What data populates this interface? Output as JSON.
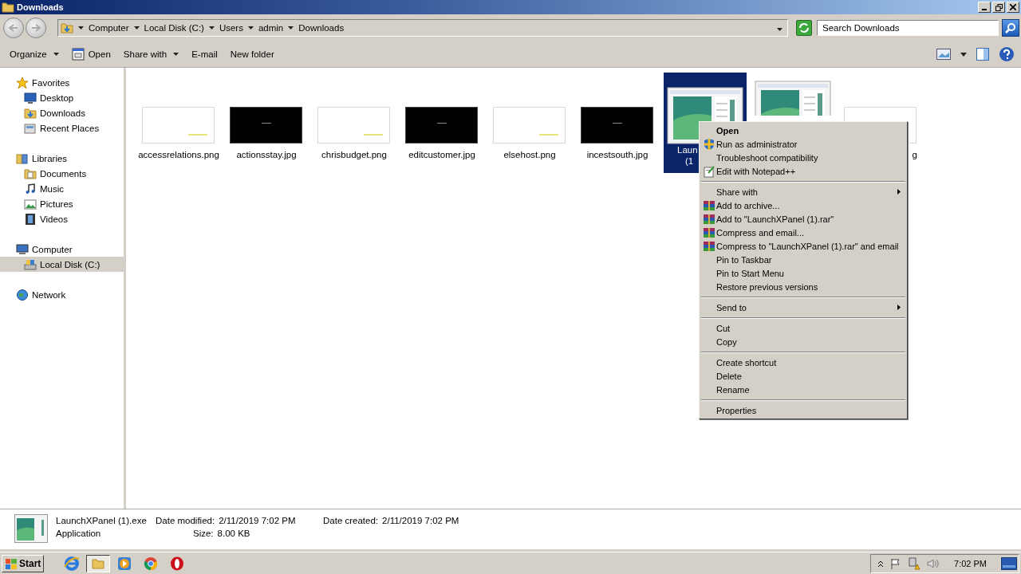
{
  "window": {
    "title": "Downloads"
  },
  "address": {
    "crumbs": [
      "Computer",
      "Local Disk (C:)",
      "Users",
      "admin",
      "Downloads"
    ]
  },
  "search": {
    "placeholder": "Search Downloads"
  },
  "toolbar": [
    {
      "label": "Organize",
      "kind": "dropdown"
    },
    {
      "label": "Open",
      "kind": "open"
    },
    {
      "label": "Share with",
      "kind": "dropdown"
    },
    {
      "label": "E-mail",
      "kind": "plain"
    },
    {
      "label": "New folder",
      "kind": "plain"
    }
  ],
  "sidebar": {
    "groups": [
      {
        "label": "Favorites",
        "kind": "star",
        "selected": false,
        "children": [
          {
            "label": "Desktop",
            "kind": "desktop",
            "selected": false
          },
          {
            "label": "Downloads",
            "kind": "folder",
            "selected": false
          },
          {
            "label": "Recent Places",
            "kind": "places",
            "selected": false
          }
        ]
      },
      {
        "label": "Libraries",
        "kind": "library",
        "selected": false,
        "children": [
          {
            "label": "Documents",
            "kind": "docs",
            "selected": false
          },
          {
            "label": "Music",
            "kind": "music",
            "selected": false
          },
          {
            "label": "Pictures",
            "kind": "pictures",
            "selected": false
          },
          {
            "label": "Videos",
            "kind": "videos",
            "selected": false
          }
        ]
      },
      {
        "label": "Computer",
        "kind": "computer",
        "selected": false,
        "children": [
          {
            "label": "Local Disk (C:)",
            "kind": "disk",
            "selected": true
          }
        ]
      },
      {
        "label": "Network",
        "kind": "network",
        "selected": false
      }
    ]
  },
  "files": [
    {
      "label": "accessrelations.png",
      "kind": "light",
      "selected": false
    },
    {
      "label": "actionsstay.jpg",
      "kind": "dark",
      "selected": false
    },
    {
      "label": "chrisbudget.png",
      "kind": "light",
      "selected": false
    },
    {
      "label": "editcustomer.jpg",
      "kind": "dark",
      "selected": false
    },
    {
      "label": "elsehost.png",
      "kind": "light",
      "selected": false
    },
    {
      "label": "incestsouth.jpg",
      "kind": "dark",
      "selected": false
    },
    {
      "label": "Laun",
      "label_2": "(1",
      "kind": "app",
      "selected": true
    },
    {
      "kind": "app_covered",
      "selected": false
    },
    {
      "label": "g",
      "kind": "blank",
      "selected": false
    }
  ],
  "context_menu": [
    {
      "kind": "plain",
      "label": "Open",
      "default": true
    },
    {
      "kind": "shield",
      "label": "Run as administrator",
      "default": false
    },
    {
      "kind": "plain",
      "label": "Troubleshoot compatibility",
      "default": false
    },
    {
      "kind": "notepad",
      "label": "Edit with Notepad++",
      "default": false
    },
    {
      "kind": "separator"
    },
    {
      "kind": "submenu",
      "label": "Share with",
      "default": false
    },
    {
      "kind": "archive",
      "label": "Add to archive...",
      "default": false
    },
    {
      "kind": "archive",
      "label": "Add to \"LaunchXPanel (1).rar\"",
      "default": false
    },
    {
      "kind": "archive",
      "label": "Compress and email...",
      "default": false
    },
    {
      "kind": "archive",
      "label": "Compress to \"LaunchXPanel (1).rar\" and email",
      "default": false
    },
    {
      "kind": "plain",
      "label": "Pin to Taskbar",
      "default": false
    },
    {
      "kind": "plain",
      "label": "Pin to Start Menu",
      "default": false
    },
    {
      "kind": "plain",
      "label": "Restore previous versions",
      "default": false
    },
    {
      "kind": "separator"
    },
    {
      "kind": "submenu",
      "label": "Send to",
      "default": false
    },
    {
      "kind": "separator"
    },
    {
      "kind": "plain",
      "label": "Cut",
      "default": false
    },
    {
      "kind": "plain",
      "label": "Copy",
      "default": false
    },
    {
      "kind": "separator"
    },
    {
      "kind": "plain",
      "label": "Create shortcut",
      "default": false
    },
    {
      "kind": "plain",
      "label": "Delete",
      "default": false
    },
    {
      "kind": "plain",
      "label": "Rename",
      "default": false
    },
    {
      "kind": "separator"
    },
    {
      "kind": "plain",
      "label": "Properties",
      "default": false
    }
  ],
  "details": {
    "name": "LaunchXPanel (1).exe",
    "type": "Application",
    "properties": [
      {
        "label": "Date modified:",
        "value": "2/11/2019 7:02 PM"
      },
      {
        "label": "Size:",
        "value": "8.00 KB"
      },
      {
        "label": "Date created:",
        "value": "2/11/2019 7:02 PM"
      }
    ]
  },
  "taskbar": {
    "start": "Start",
    "apps": [
      {
        "kind": "ie",
        "selected": false
      },
      {
        "kind": "explorer",
        "selected": true
      },
      {
        "kind": "media",
        "selected": false
      },
      {
        "kind": "chrome",
        "selected": false
      },
      {
        "kind": "opera",
        "selected": false
      }
    ],
    "clock": "7:02 PM"
  }
}
